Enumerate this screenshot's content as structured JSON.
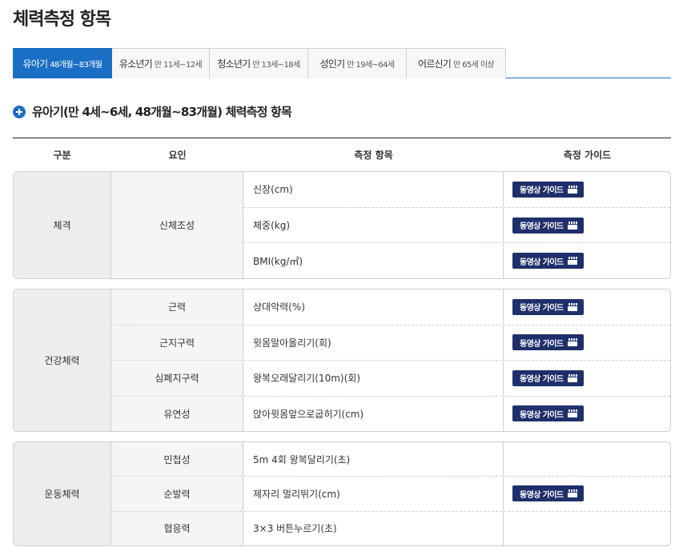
{
  "page_title": "체력측정 항목",
  "tabs": [
    {
      "label": "유아기",
      "sub": "48개월~83개월",
      "active": true
    },
    {
      "label": "유소년기",
      "sub": "만 11세~12세",
      "active": false
    },
    {
      "label": "청소년기",
      "sub": "만 13세~18세",
      "active": false
    },
    {
      "label": "성인기",
      "sub": "만 19세~64세",
      "active": false
    },
    {
      "label": "어르신기",
      "sub": "만 65세 이상",
      "active": false
    }
  ],
  "section_title": "유아기(만 4세~6세, 48개월~83개월) 체력측정 항목",
  "table": {
    "headers": [
      "구분",
      "요인",
      "측정 항목",
      "측정 가이드"
    ],
    "guide_label": "동영상 가이드",
    "groups": [
      {
        "category": "체격",
        "rows": [
          {
            "factor": "신체조성",
            "item": "신장(cm)",
            "guide": true
          },
          {
            "factor": "",
            "item": "체중(kg)",
            "guide": true
          },
          {
            "factor": "",
            "item": "BMI(kg/㎡)",
            "guide": true
          }
        ]
      },
      {
        "category": "건강체력",
        "rows": [
          {
            "factor": "근력",
            "item": "상대악력(%)",
            "guide": true
          },
          {
            "factor": "근지구력",
            "item": "윗몸말아올리기(회)",
            "guide": true
          },
          {
            "factor": "심폐지구력",
            "item": "왕복오래달리기(10m)(회)",
            "guide": true
          },
          {
            "factor": "유연성",
            "item": "앉아윗몸앞으로굽히기(cm)",
            "guide": true
          }
        ]
      },
      {
        "category": "운동체력",
        "rows": [
          {
            "factor": "민첩성",
            "item": "5m 4회 왕복달리기(초)",
            "guide": false
          },
          {
            "factor": "순발력",
            "item": "제자리 멀리뛰기(cm)",
            "guide": true
          },
          {
            "factor": "협응력",
            "item": "3×3 버튼누르기(초)",
            "guide": false
          }
        ]
      }
    ]
  }
}
